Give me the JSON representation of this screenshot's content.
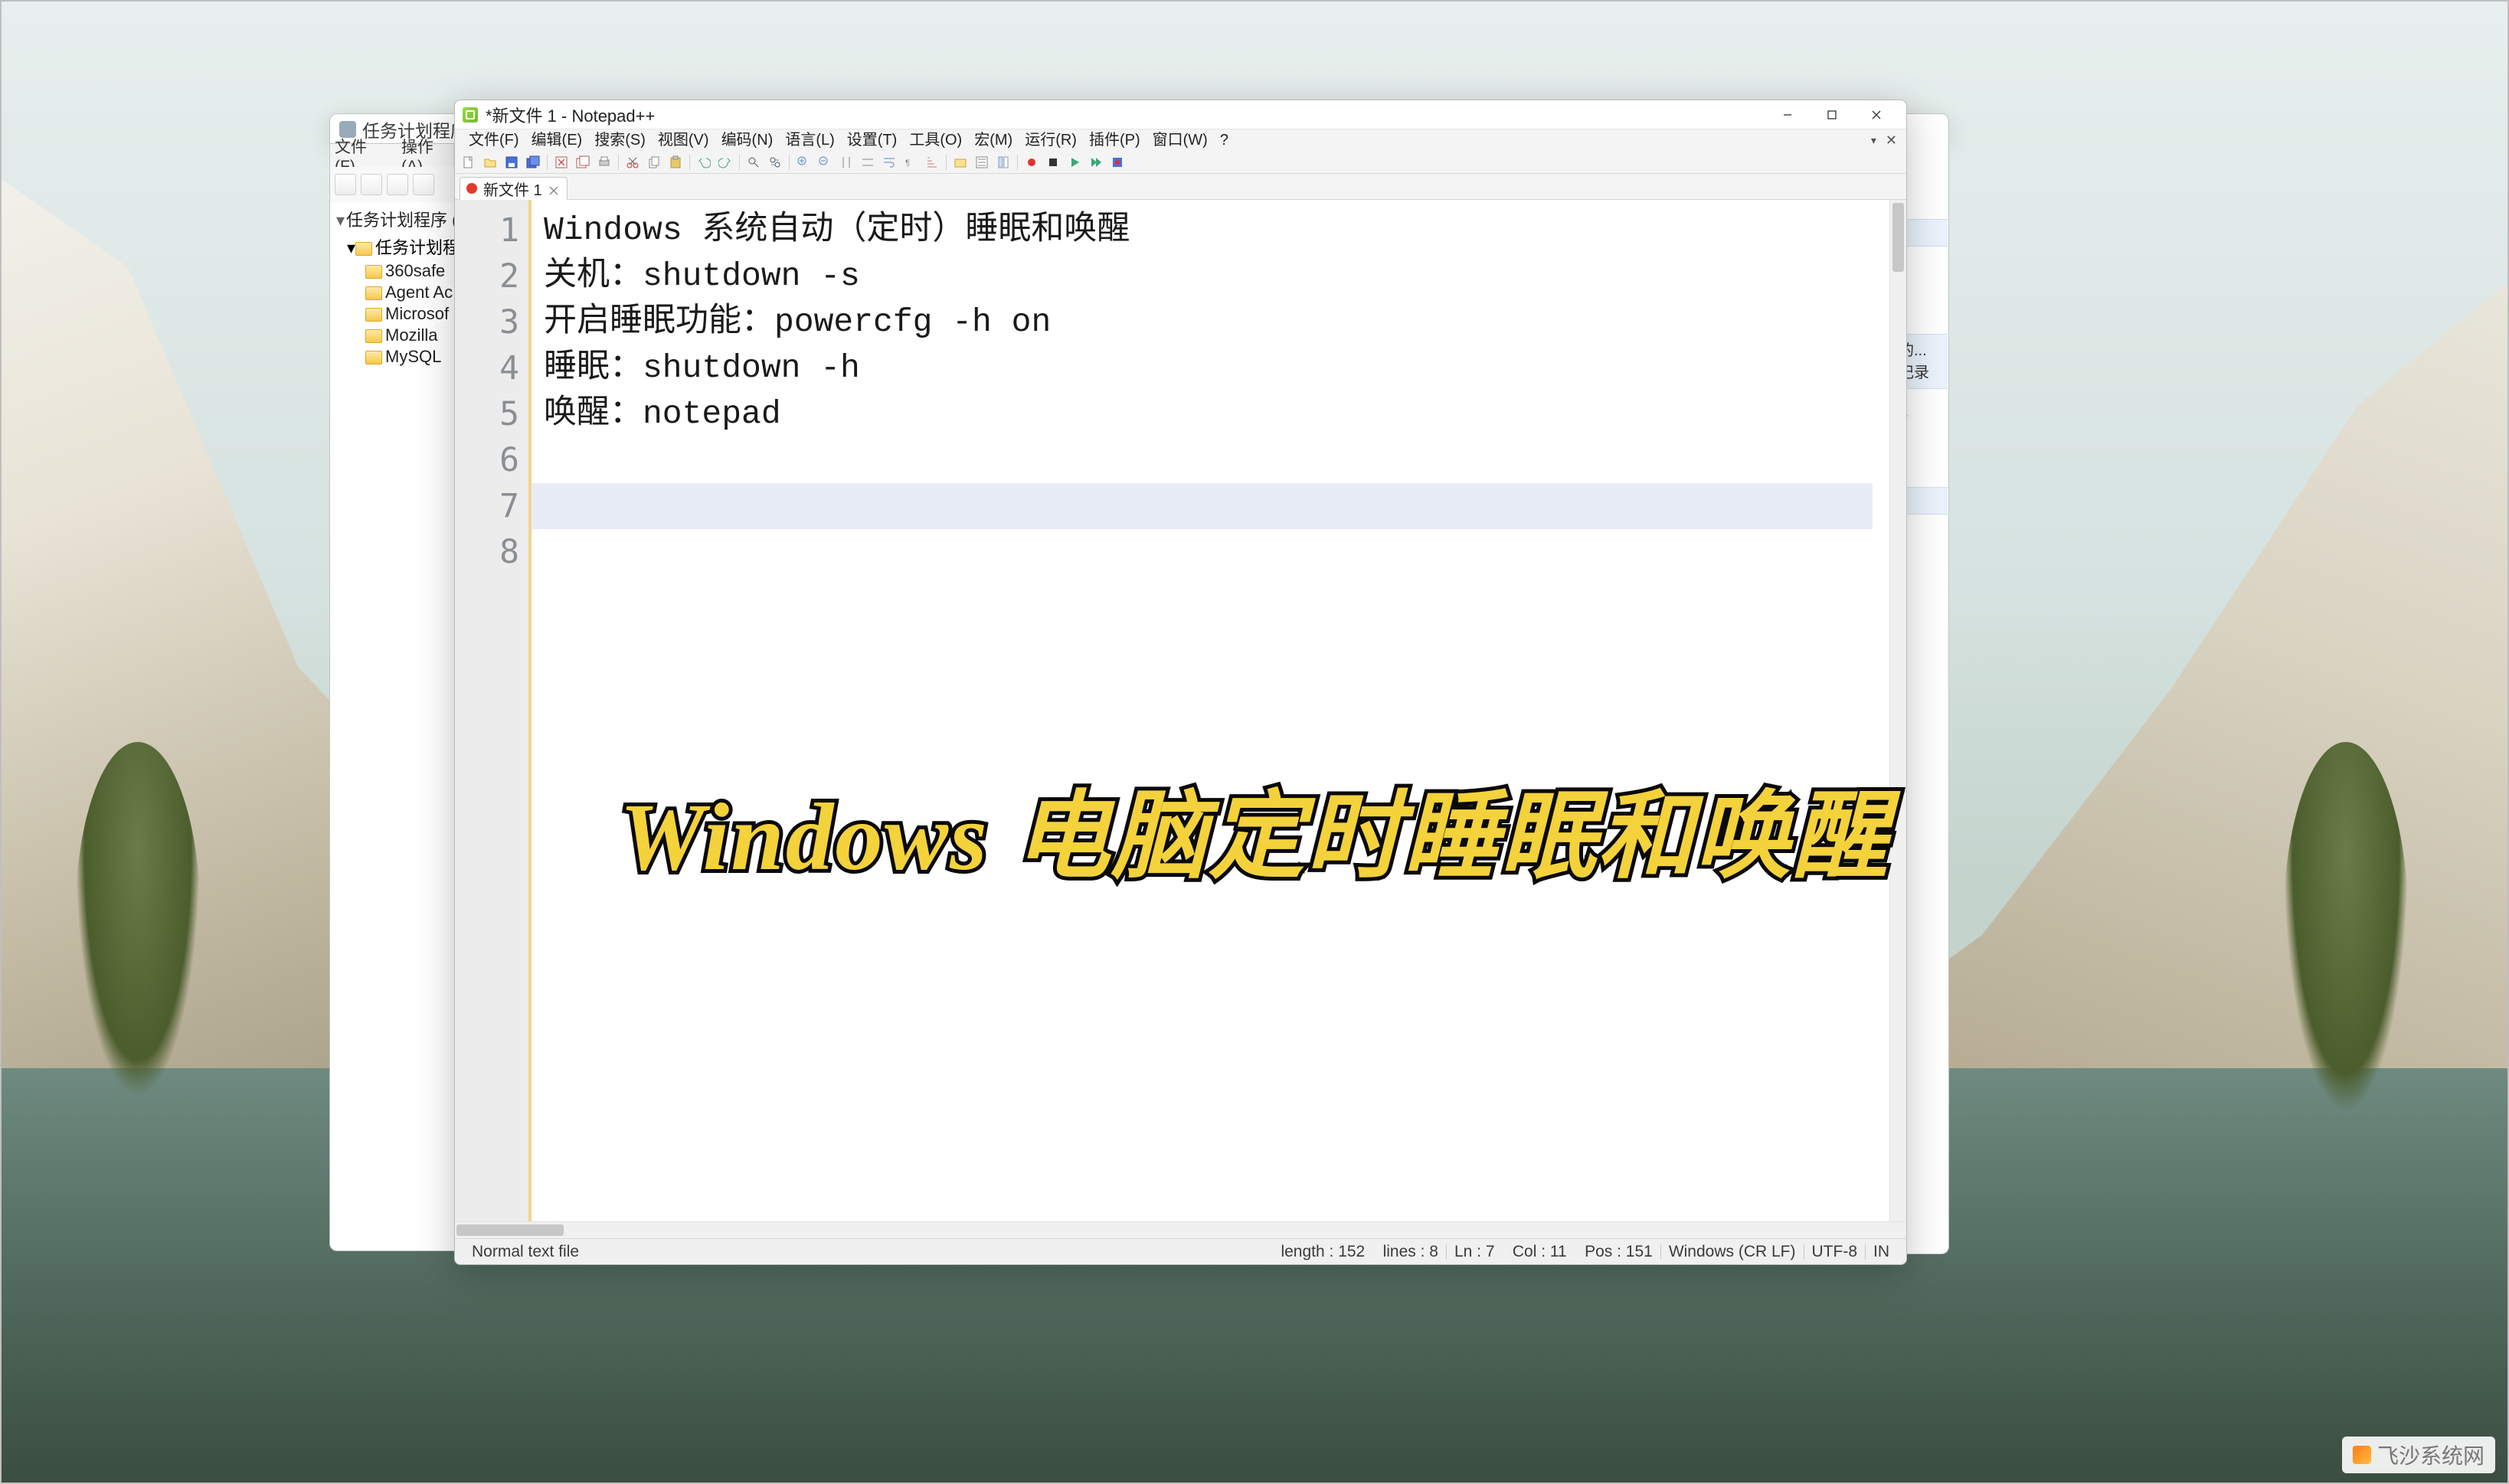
{
  "task_scheduler": {
    "title": "任务计划程序",
    "menu": {
      "file": "文件(F)",
      "action": "操作(A)"
    },
    "root": "任务计划程序 (本",
    "lib": "任务计划程序",
    "items": [
      "360safe",
      "Agent Ac",
      "Microsof",
      "Mozilla",
      "MySQL"
    ],
    "peek": {
      "text1": "的...",
      "text2": "记录"
    }
  },
  "notepadpp": {
    "title": "*新文件 1 - Notepad++",
    "menus": [
      "文件(F)",
      "编辑(E)",
      "搜索(S)",
      "视图(V)",
      "编码(N)",
      "语言(L)",
      "设置(T)",
      "工具(O)",
      "宏(M)",
      "运行(R)",
      "插件(P)",
      "窗口(W)",
      "?"
    ],
    "tab": {
      "label": "新文件 1"
    },
    "lines": [
      "Windows 系统自动（定时）睡眠和唤醒",
      "",
      "关机：shutdown -s",
      "",
      "开启睡眠功能：powercfg -h on",
      "睡眠：shutdown -h",
      "唤醒：notepad",
      ""
    ],
    "statusbar": {
      "filetype": "Normal text file",
      "length_label": "length :",
      "length_value": "152",
      "lines_label": "lines :",
      "lines_value": "8",
      "ln_label": "Ln :",
      "ln_value": "7",
      "col_label": "Col :",
      "col_value": "11",
      "pos_label": "Pos :",
      "pos_value": "151",
      "eol": "Windows (CR LF)",
      "encoding": "UTF-8",
      "ins": "IN"
    }
  },
  "caption": "Windows  电脑定时睡眠和唤醒",
  "watermark": "飞沙系统网"
}
